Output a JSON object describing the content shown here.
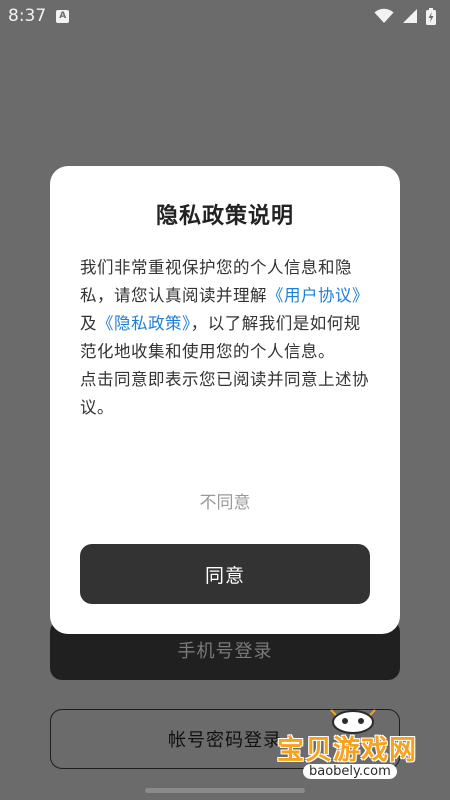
{
  "status_bar": {
    "time": "8:37",
    "app_icon_letter": "A",
    "icons": [
      "app-notification-icon",
      "wifi-icon",
      "signal-icon",
      "battery-charging-icon"
    ]
  },
  "background": {
    "phone_login_label": "手机号登录",
    "password_login_label": "帐号密码登录"
  },
  "dialog": {
    "title": "隐私政策说明",
    "body_intro": "我们非常重视保护您的个人信息和隐私，请您认真阅读并理解",
    "user_agreement_link": "《用户协议》",
    "and": "及",
    "privacy_policy_link": "《隐私政策》",
    "body_rest": "，以了解我们是如何规范化地收集和使用您的个人信息。",
    "body_consent": "点击同意即表示您已阅读并同意上述协议。",
    "disagree_label": "不同意",
    "agree_label": "同意"
  },
  "watermark": {
    "title": "宝贝游戏网",
    "url": "baobely.com"
  },
  "colors": {
    "overlay": "#6b6b6b",
    "link": "#1e7fd8",
    "agree_button": "#333333",
    "watermark": "#f7a21a"
  }
}
